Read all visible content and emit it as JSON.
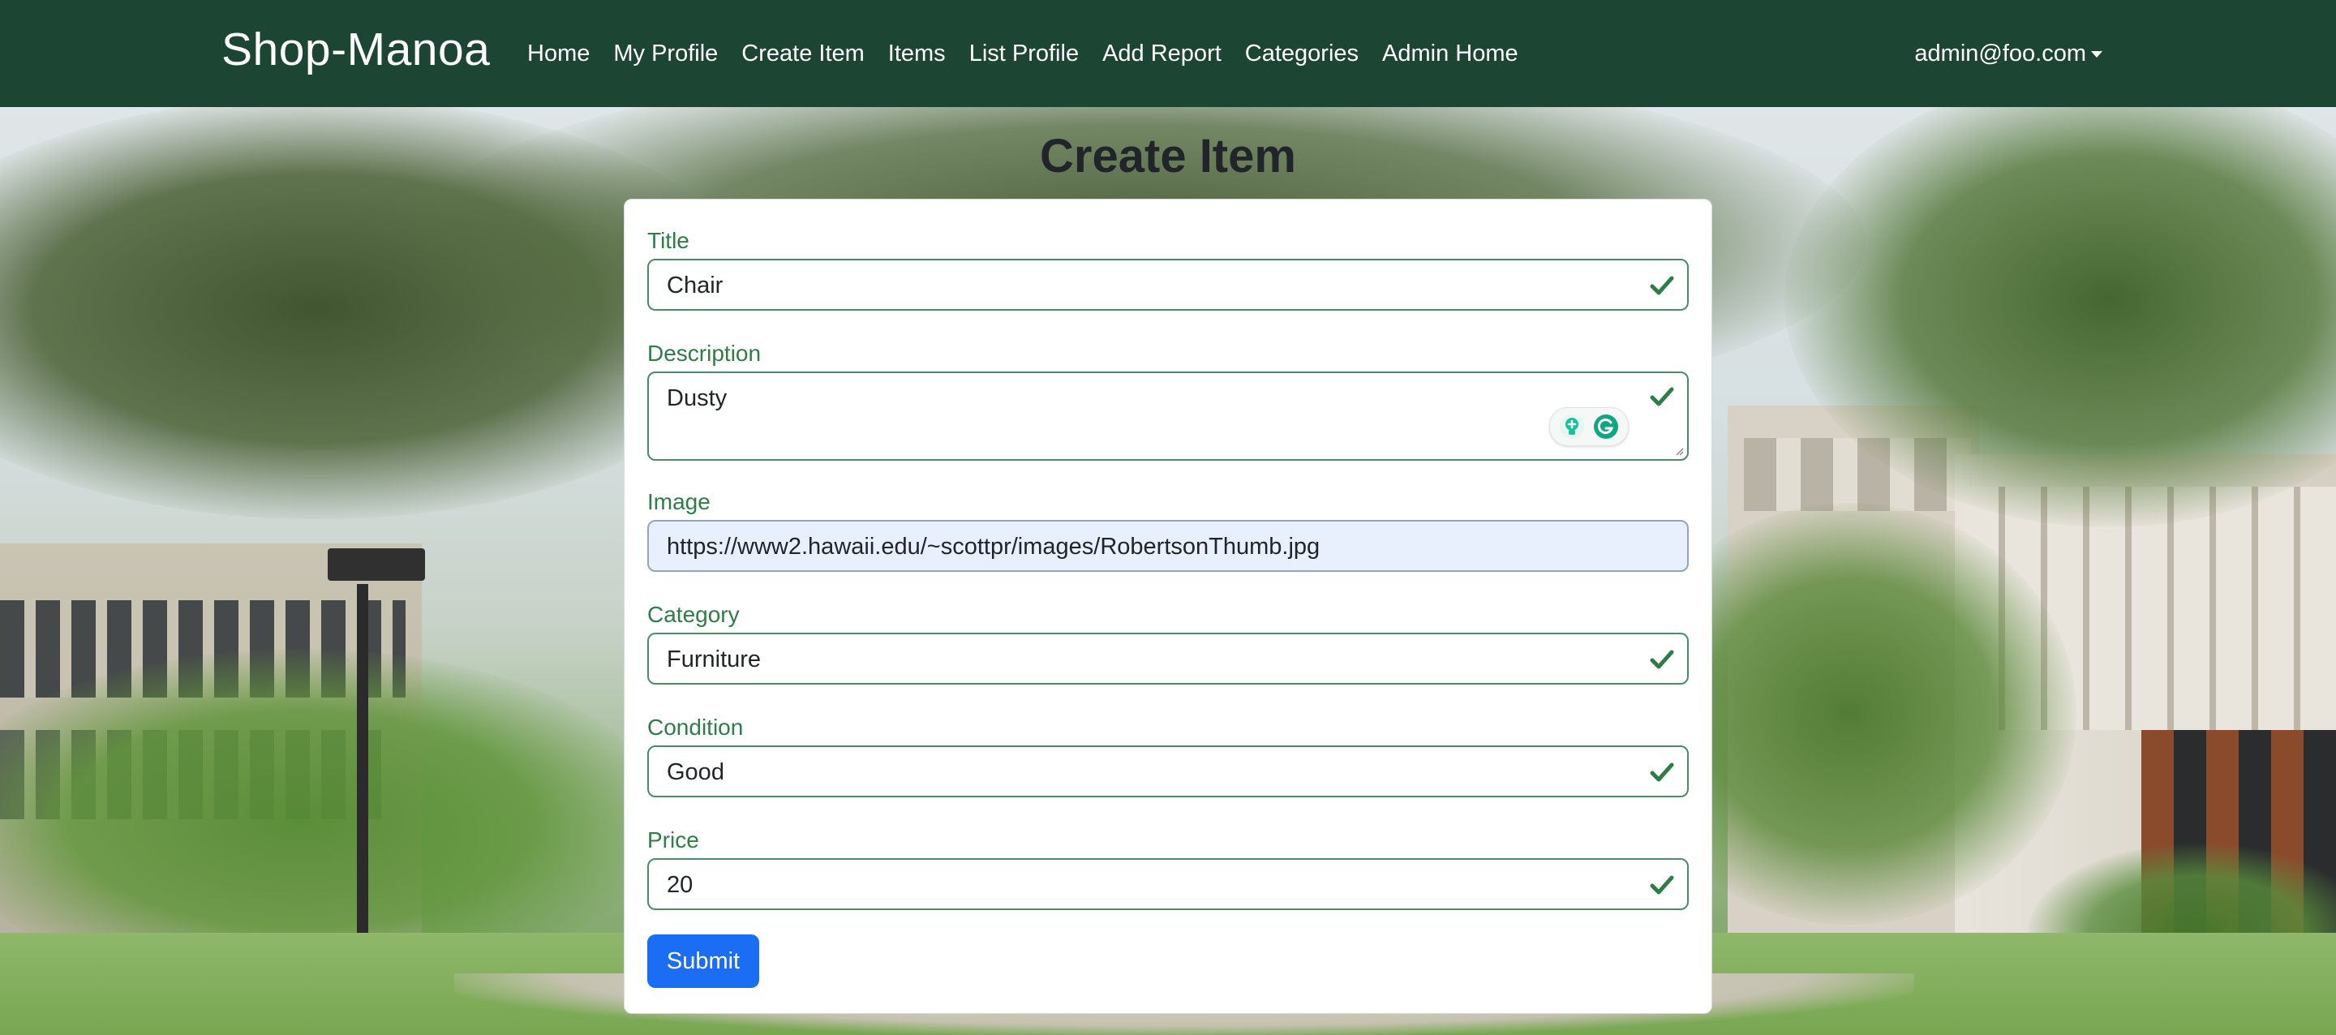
{
  "navbar": {
    "brand": "Shop-Manoa",
    "links": [
      "Home",
      "My Profile",
      "Create Item",
      "Items",
      "List Profile",
      "Add Report",
      "Categories",
      "Admin Home"
    ],
    "user": "admin@foo.com"
  },
  "page": {
    "title": "Create Item"
  },
  "form": {
    "fields": [
      {
        "label": "Title",
        "value": "Chair"
      },
      {
        "label": "Description",
        "value": "Dusty"
      },
      {
        "label": "Image",
        "value": "https://www2.hawaii.edu/~scottpr/images/RobertsonThumb.jpg"
      },
      {
        "label": "Category",
        "value": "Furniture"
      },
      {
        "label": "Condition",
        "value": "Good"
      },
      {
        "label": "Price",
        "value": "20"
      }
    ],
    "submit_label": "Submit"
  },
  "colors": {
    "navbar": "#1c4633",
    "valid_green": "#2e7d46",
    "submit_blue": "#1b6ef3",
    "autofill_bg": "#e8f0fe"
  },
  "icons": [
    "check-icon",
    "grammarly-icon",
    "caret-down-icon",
    "resize-handle-icon"
  ]
}
